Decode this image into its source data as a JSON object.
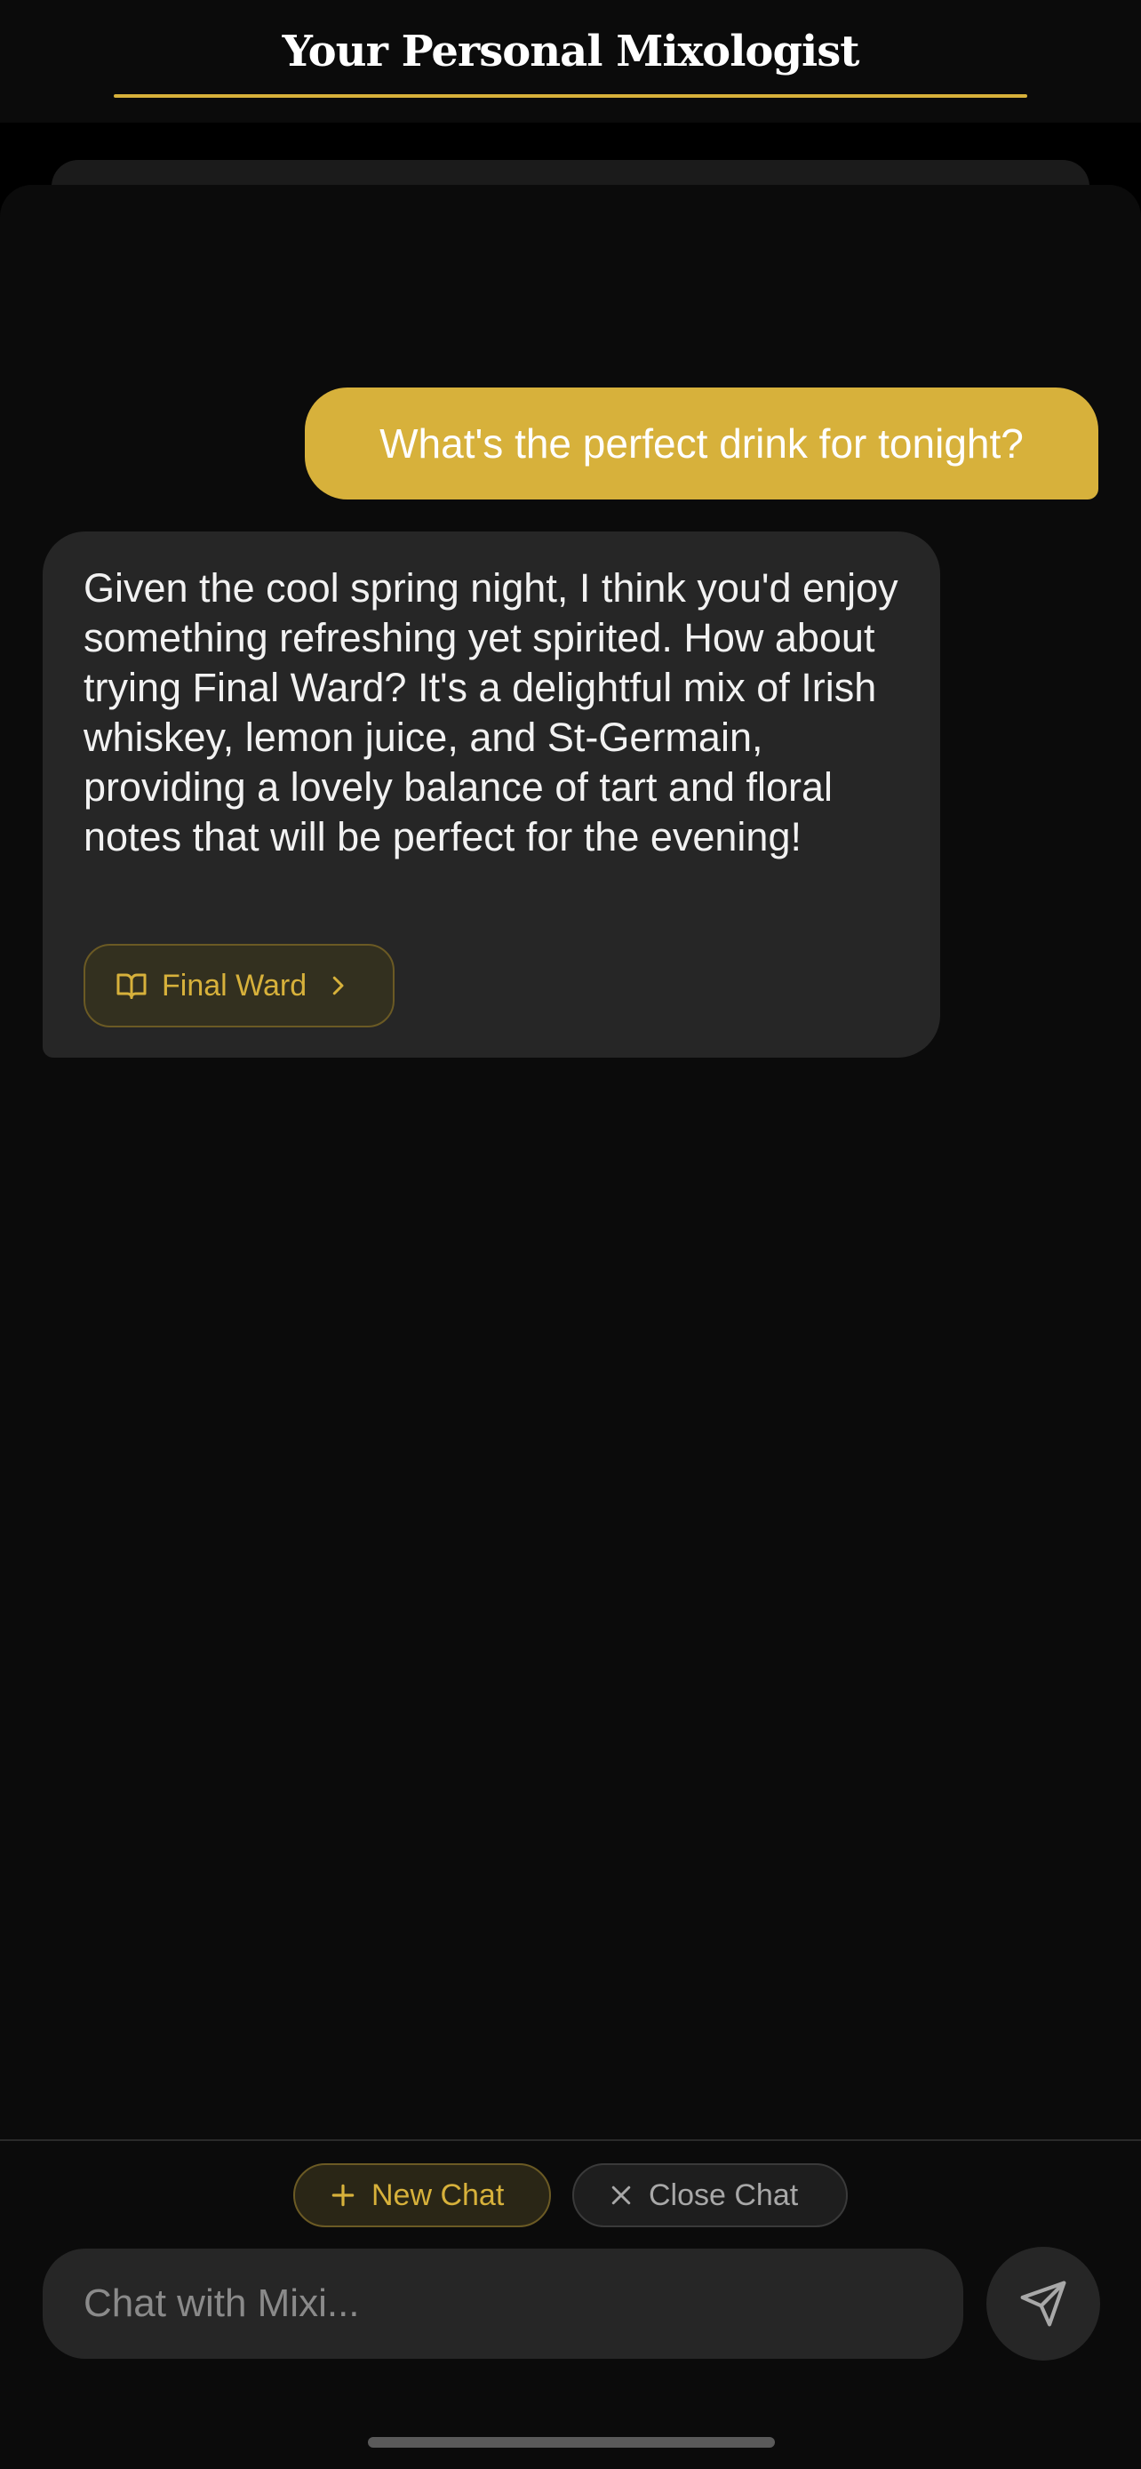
{
  "header": {
    "title": "Your Personal Mixologist"
  },
  "chat": {
    "user_message": "What's the perfect drink for tonight?",
    "bot_message": "Given the cool spring night, I think you'd enjoy something refreshing yet spirited. How about trying Final Ward? It's a delightful mix of Irish whiskey, lemon juice, and St-Germain, providing a lovely balance of tart and floral notes that will be perfect for the evening!",
    "recipe_chip": {
      "label": "Final Ward",
      "icon": "book-open-icon",
      "trailing_icon": "chevron-right-icon"
    }
  },
  "actions": {
    "new_chat": {
      "label": "New Chat",
      "icon": "plus-icon"
    },
    "close_chat": {
      "label": "Close Chat",
      "icon": "x-icon"
    }
  },
  "composer": {
    "placeholder": "Chat with Mixi...",
    "send_icon": "send-icon"
  },
  "colors": {
    "accent": "#d7b13b",
    "background": "#0b0b0b",
    "bubble": "#262626"
  }
}
